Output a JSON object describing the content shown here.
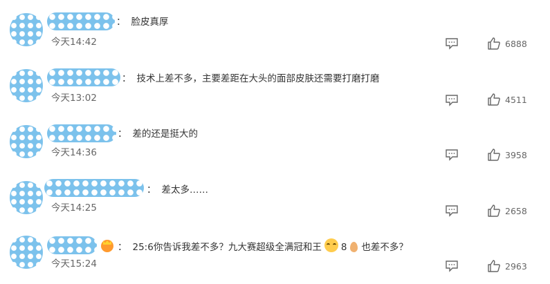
{
  "comments": [
    {
      "text": "脸皮真厚",
      "time": "今天14:42",
      "likes": "6888",
      "username_width_frac": 0.12
    },
    {
      "text": "技术上差不多，主要差距在大头的面部皮肤还需要打磨打磨",
      "time": "今天13:02",
      "likes": "4511"
    },
    {
      "text": "差的还是挺大的",
      "time": "今天14:36",
      "likes": "3958"
    },
    {
      "text": "差太多……",
      "time": "今天14:25",
      "likes": "2658"
    },
    {
      "text_a": "25:6你告诉我差不多？九大赛超级全满冠和王",
      "text_b": "8",
      "text_c": "也差不多？",
      "time": "今天15:24",
      "likes": "2963"
    }
  ],
  "separator": "：",
  "icons": {
    "reply": "comment-bubble-icon",
    "like": "thumbs-up-icon",
    "avatar": "polka-dot-avatar",
    "crown": "crown-emoji-icon",
    "cry": "crying-face-emoji-icon",
    "egg": "egg-emoji-icon"
  },
  "colors": {
    "avatar_blue": "#7cc2ec",
    "text": "#333333",
    "muted": "#666666"
  }
}
